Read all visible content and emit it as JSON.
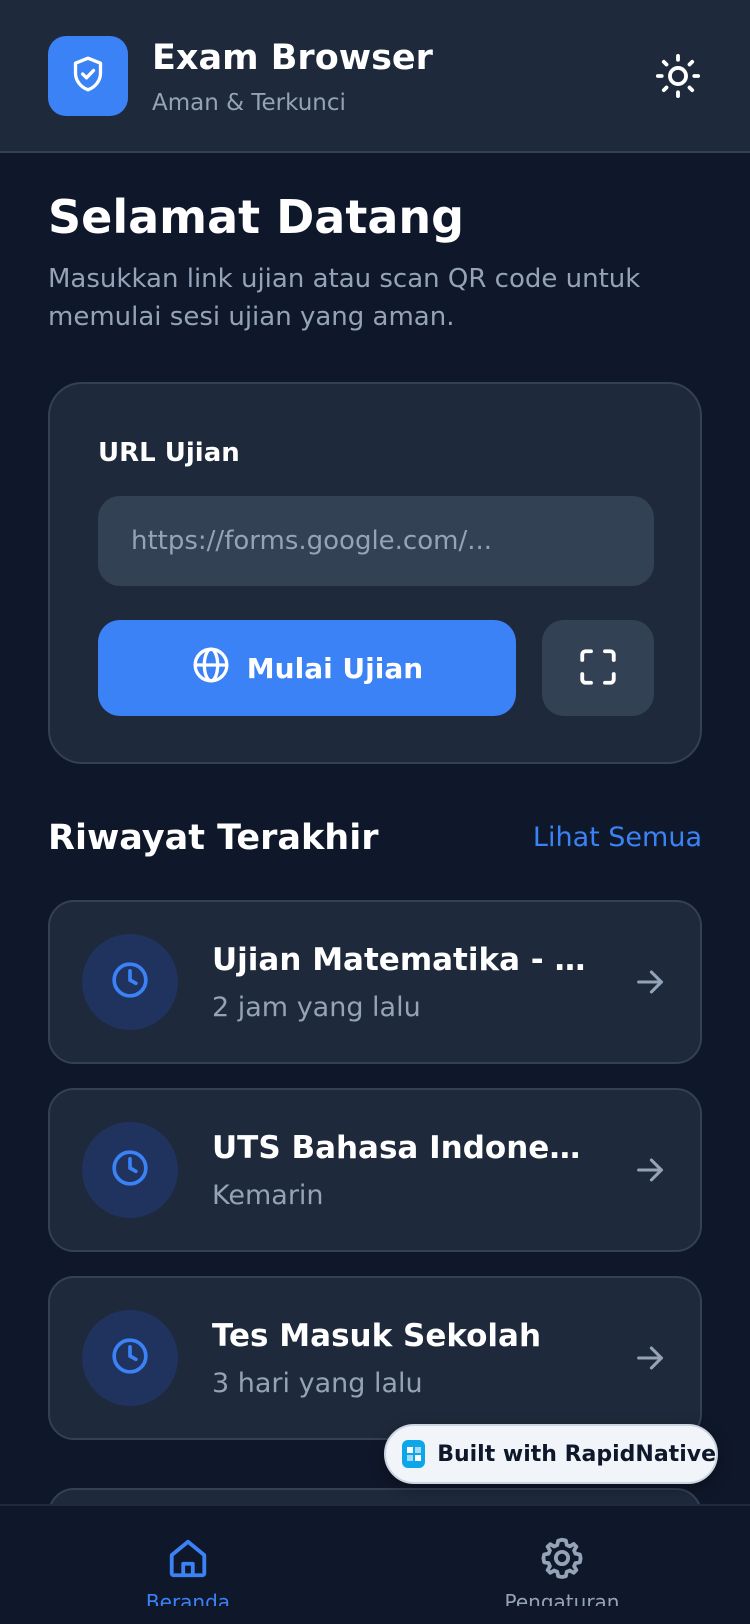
{
  "header": {
    "title": "Exam Browser",
    "subtitle": "Aman & Terkunci",
    "logo_icon": "shield-check-icon",
    "theme_icon": "sun-icon"
  },
  "welcome": {
    "title": "Selamat Datang",
    "description": "Masukkan link ujian atau scan QR code untuk memulai sesi ujian yang aman."
  },
  "url_form": {
    "label": "URL Ujian",
    "placeholder": "https://forms.google.com/...",
    "value": "",
    "start_label": "Mulai Ujian",
    "start_icon": "globe-icon",
    "scan_icon": "scan-frame-icon"
  },
  "history": {
    "title": "Riwayat Terakhir",
    "see_all": "Lihat Semua",
    "items": [
      {
        "title": "Ujian Matematika - Se...",
        "time": "2 jam yang lalu"
      },
      {
        "title": "UTS Bahasa Indonesia",
        "time": "Kemarin"
      },
      {
        "title": "Tes Masuk Sekolah",
        "time": "3 hari yang lalu"
      }
    ]
  },
  "badge": {
    "text": "Built with RapidNative"
  },
  "bottom_nav": {
    "items": [
      {
        "label": "Beranda",
        "icon": "home-icon",
        "active": true
      },
      {
        "label": "Pengaturan",
        "icon": "gear-icon",
        "active": false
      }
    ]
  },
  "colors": {
    "background": "#0f172a",
    "surface": "#1e293b",
    "accent": "#3b82f6",
    "muted_text": "#94a3b8"
  }
}
